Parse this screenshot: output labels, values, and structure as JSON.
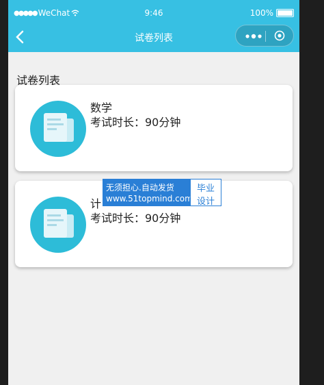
{
  "status_bar": {
    "carrier": "WeChat",
    "time": "9:46",
    "battery": "100%"
  },
  "nav": {
    "title": "试卷列表"
  },
  "section_title": "试卷列表",
  "exams": [
    {
      "name": "数学",
      "duration": "考试时长：90分钟"
    },
    {
      "name": "计",
      "duration": "考试时长：90分钟"
    }
  ],
  "watermark": {
    "line1": "无须担心.自动发货",
    "line2": "www.51topmind.com",
    "side1": "毕业",
    "side2": "设计"
  },
  "colors": {
    "primary": "#37c0e3",
    "icon_bg": "#2dbcd8",
    "watermark": "#2a7fd6"
  }
}
